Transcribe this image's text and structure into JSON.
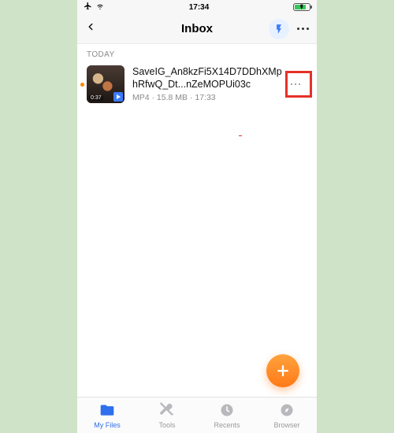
{
  "status": {
    "time": "17:34"
  },
  "nav": {
    "title": "Inbox"
  },
  "section": {
    "header": "TODAY"
  },
  "file": {
    "name": "SaveIG_An8kzFi5X14D7DDhXMphRfwQ_Dt...nZeMOPUi03c",
    "meta": "MP4  ·  15.8 MB  ·  17:33",
    "duration": "0:37"
  },
  "fab": {
    "label": "+"
  },
  "tabs": {
    "items": [
      {
        "label": "My Files"
      },
      {
        "label": "Tools"
      },
      {
        "label": "Recents"
      },
      {
        "label": "Browser"
      }
    ]
  },
  "icons": {
    "airplane": "airplane-icon",
    "wifi": "wifi-icon",
    "battery": "battery-icon",
    "back": "chevron-left-icon",
    "bolt": "bolt-icon",
    "more": "more-icon",
    "folder": "folder-icon",
    "tools": "tools-icon",
    "recents": "clock-icon",
    "browser": "compass-icon"
  },
  "colors": {
    "accent": "#2f6fed",
    "fab_start": "#ffa23e",
    "fab_end": "#ff7a18",
    "highlight": "#e53127",
    "battery_fill": "#35c759"
  }
}
